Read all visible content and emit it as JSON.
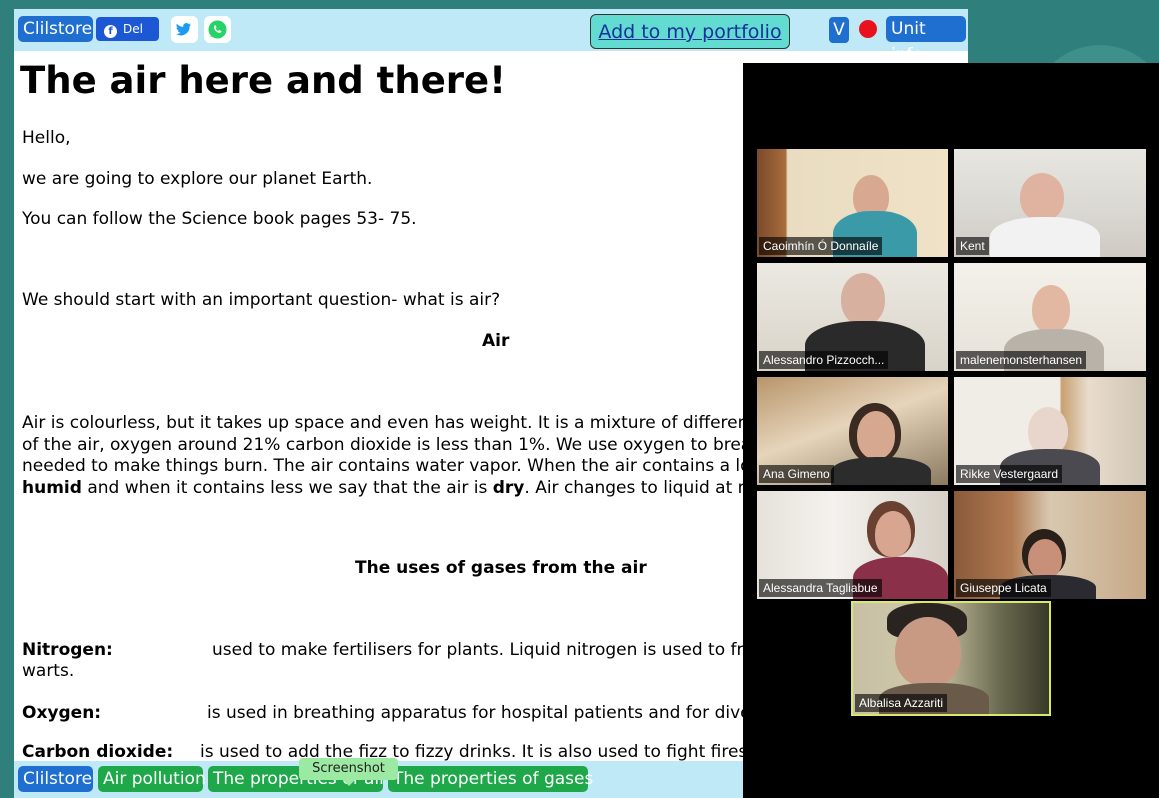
{
  "toolbar": {
    "clilstore_label": "Clilstore",
    "fb_label": "Del",
    "portfolio_label": "Add to my portfolio",
    "v_label": "V",
    "unit_info_label": "Unit info"
  },
  "content": {
    "title": "The air here and there!",
    "greeting": "Hello,",
    "intro1": "we are going to explore our planet Earth.",
    "intro2": "You can follow the Science book pages 53- 75.",
    "question": "We should start with an important question- what is air?",
    "heading_air": "Air",
    "para_line1": "Air is colourless, but it takes up space and even has weight. It is a mixture of different g",
    "para_line2": "of the air, oxygen around 21% carbon dioxide is less than 1%. We use oxygen to breath",
    "para_line3": "needed to make things burn. The air contains water vapor. When the air contains a lot o",
    "para_line4_b1": "humid",
    "para_line4_t1": " and when it contains less we say that the air is ",
    "para_line4_b2": "dry",
    "para_line4_t2": ". Air changes to liquid at min",
    "heading_uses": "The uses of gases from the air",
    "nitrogen_term": "Nitrogen:",
    "nitrogen_desc": "used to make fertilisers for plants. Liquid nitrogen is used to free",
    "nitrogen_desc2": "warts.",
    "oxygen_term": "Oxygen:",
    "oxygen_desc": "is used in breathing apparatus for hospital patients and for divers.",
    "co2_term": "Carbon dioxide:",
    "co2_desc": "is used to add the fizz to fizzy drinks. It is also used to fight fires. I"
  },
  "bottombar": {
    "clilstore_label": "Clilstore",
    "link1": "Air pollution",
    "link2": "The properties of air",
    "link3": "The properties of gases"
  },
  "tooltip": "Screenshot",
  "participants": [
    {
      "name": "Caoimhín Ó Donnaíle"
    },
    {
      "name": "Kent"
    },
    {
      "name": "Alessandro Pizzocch..."
    },
    {
      "name": "malenemonsterhansen"
    },
    {
      "name": "Ana Gimeno"
    },
    {
      "name": "Rikke Vestergaard"
    },
    {
      "name": "Alessandra Tagliabue"
    },
    {
      "name": "Giuseppe Licata"
    },
    {
      "name": "Albalisa Azzariti"
    }
  ],
  "colors": {
    "accent_blue": "#1f6fd0",
    "link_green": "#1fa84a",
    "toolbar_bg": "#bfe9f6",
    "active_speaker": "#d8e86a"
  }
}
